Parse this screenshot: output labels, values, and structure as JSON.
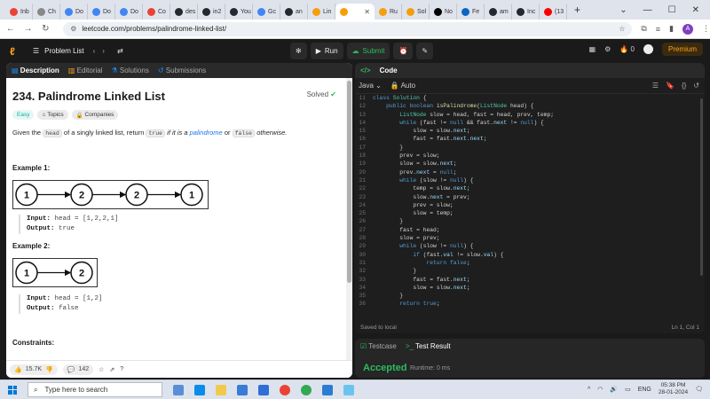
{
  "browser": {
    "tabs": [
      {
        "label": "Inb",
        "color": "#ea4335"
      },
      {
        "label": "Ch",
        "color": "#888888"
      },
      {
        "label": "Do",
        "color": "#4285f4"
      },
      {
        "label": "Do",
        "color": "#4285f4"
      },
      {
        "label": "Do",
        "color": "#4285f4"
      },
      {
        "label": "Co",
        "color": "#ea4335"
      },
      {
        "label": "des",
        "color": "#24292f"
      },
      {
        "label": "in2",
        "color": "#24292f"
      },
      {
        "label": "You",
        "color": "#24292f"
      },
      {
        "label": "Gc",
        "color": "#4285f4"
      },
      {
        "label": "an",
        "color": "#24292f"
      },
      {
        "label": "Lin",
        "color": "#f59e0b"
      },
      {
        "label": "",
        "color": "#f59e0b",
        "active": true
      },
      {
        "label": "Ru",
        "color": "#f59e0b"
      },
      {
        "label": "Sol",
        "color": "#f59e0b"
      },
      {
        "label": "No",
        "color": "#000000"
      },
      {
        "label": "Fe",
        "color": "#0a66c2"
      },
      {
        "label": "am",
        "color": "#24292f"
      },
      {
        "label": "Inc",
        "color": "#24292f"
      },
      {
        "label": "(13",
        "color": "#ff0000"
      }
    ],
    "url": "leetcode.com/problems/palindrome-linked-list/",
    "profile_initial": "A"
  },
  "nav": {
    "problem_list": "Problem List",
    "run": "Run",
    "submit": "Submit",
    "streak": "0",
    "premium": "Premium"
  },
  "left": {
    "tabs": {
      "description": "Description",
      "editorial": "Editorial",
      "solutions": "Solutions",
      "submissions": "Submissions"
    },
    "title": "234. Palindrome Linked List",
    "solved": "Solved",
    "badges": {
      "difficulty": "Easy",
      "topics": "Topics",
      "companies": "Companies"
    },
    "intro": {
      "p1": "Given the",
      "code1": "head",
      "p2": "of a singly linked list, return",
      "code2": "true",
      "p3": "if it is a",
      "link": "palindrome",
      "p4": "or",
      "code3": "false",
      "p5": "otherwise."
    },
    "example1": {
      "heading": "Example 1:",
      "nodes": [
        "1",
        "2",
        "2",
        "1"
      ],
      "input_label": "Input:",
      "input": "head = [1,2,2,1]",
      "output_label": "Output:",
      "output": "true"
    },
    "example2": {
      "heading": "Example 2:",
      "nodes": [
        "1",
        "2"
      ],
      "input_label": "Input:",
      "input": "head = [1,2]",
      "output_label": "Output:",
      "output": "false"
    },
    "constraints": "Constraints:",
    "footer": {
      "likes": "15.7K",
      "comments": "142"
    }
  },
  "right": {
    "title": "Code",
    "language": "Java",
    "mode": "Auto",
    "saved": "Saved to local",
    "cursor": "Ln 1, Col 1",
    "code_lines": [
      {
        "n": "11",
        "t": "class Solution {"
      },
      {
        "n": "12",
        "t": "    public boolean isPalindrome(ListNode head) {"
      },
      {
        "n": "13",
        "t": "        ListNode slow = head, fast = head, prev, temp;"
      },
      {
        "n": "14",
        "t": "        while (fast != null && fast.next != null) {"
      },
      {
        "n": "15",
        "t": "            slow = slow.next;"
      },
      {
        "n": "16",
        "t": "            fast = fast.next.next;"
      },
      {
        "n": "17",
        "t": "        }"
      },
      {
        "n": "18",
        "t": "        prev = slow;"
      },
      {
        "n": "19",
        "t": "        slow = slow.next;"
      },
      {
        "n": "20",
        "t": "        prev.next = null;"
      },
      {
        "n": "21",
        "t": "        while (slow != null) {"
      },
      {
        "n": "22",
        "t": "            temp = slow.next;"
      },
      {
        "n": "23",
        "t": "            slow.next = prev;"
      },
      {
        "n": "24",
        "t": "            prev = slow;"
      },
      {
        "n": "25",
        "t": "            slow = temp;"
      },
      {
        "n": "26",
        "t": "        }"
      },
      {
        "n": "27",
        "t": "        fast = head;"
      },
      {
        "n": "28",
        "t": "        slow = prev;"
      },
      {
        "n": "29",
        "t": "        while (slow != null) {"
      },
      {
        "n": "30",
        "t": "            if (fast.val != slow.val) {"
      },
      {
        "n": "31",
        "t": "                return false;"
      },
      {
        "n": "32",
        "t": "            }"
      },
      {
        "n": "33",
        "t": "            fast = fast.next;"
      },
      {
        "n": "34",
        "t": "            slow = slow.next;"
      },
      {
        "n": "35",
        "t": "        }"
      },
      {
        "n": "36",
        "t": "        return true;"
      }
    ]
  },
  "test": {
    "testcase": "Testcase",
    "result": "Test Result",
    "status": "Accepted",
    "runtime": "Runtime: 0 ms"
  },
  "taskbar": {
    "search_placeholder": "Type here to search",
    "lang": "ENG",
    "time": "05:38 PM",
    "date": "28-01-2024"
  }
}
